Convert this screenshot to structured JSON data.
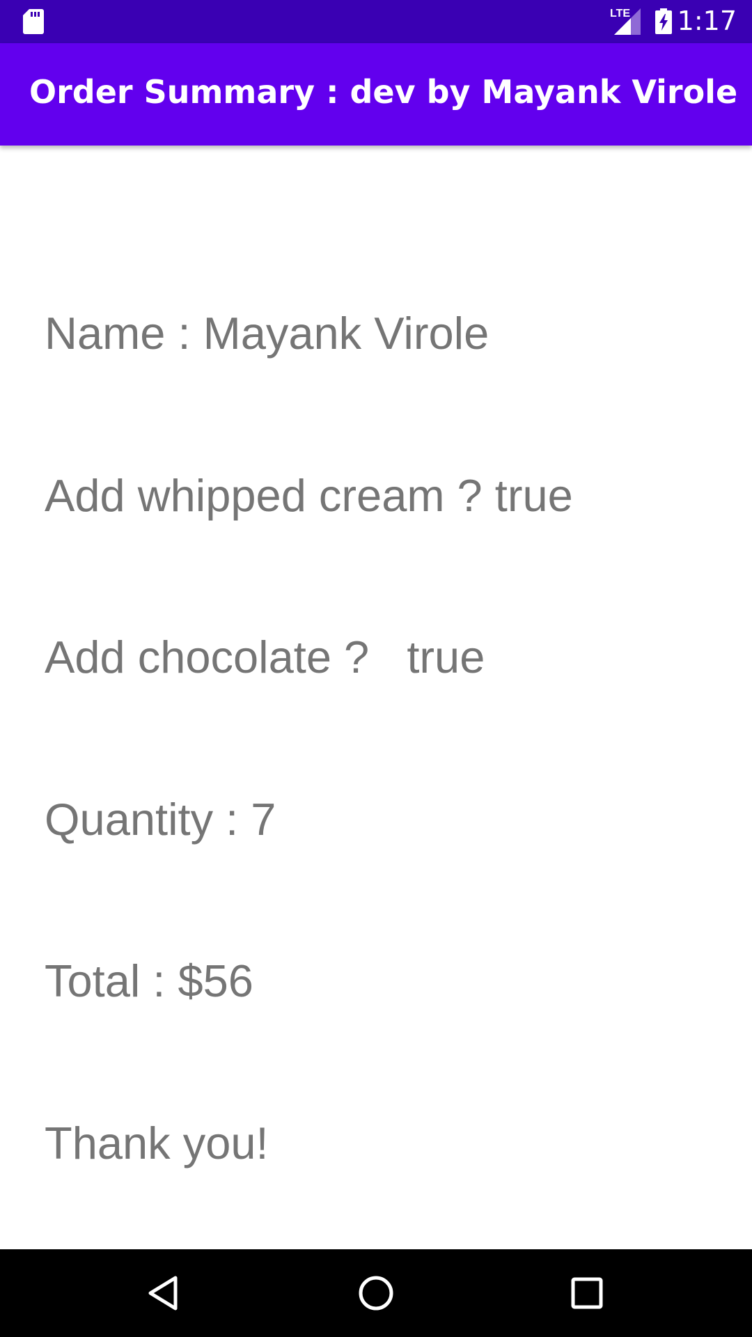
{
  "status_bar": {
    "time": "1:17",
    "network_label": "LTE",
    "icons": [
      "sd-card-icon",
      "lte-signal-icon",
      "battery-charging-icon"
    ]
  },
  "app_bar": {
    "title": "Order Summary : dev by Mayank Virole"
  },
  "order_summary": {
    "lines": [
      "Name : Mayank Virole",
      "Add whipped cream ? true",
      "Add chocolate ?   true",
      "Quantity : 7",
      "Total : $56",
      "Thank you!"
    ]
  },
  "nav_bar": {
    "icons": [
      "back-icon",
      "home-icon",
      "recents-icon"
    ]
  },
  "colors": {
    "status_bar": "#3a00b3",
    "app_bar": "#6200ee",
    "summary_text": "#757575",
    "nav_bar": "#000000"
  }
}
